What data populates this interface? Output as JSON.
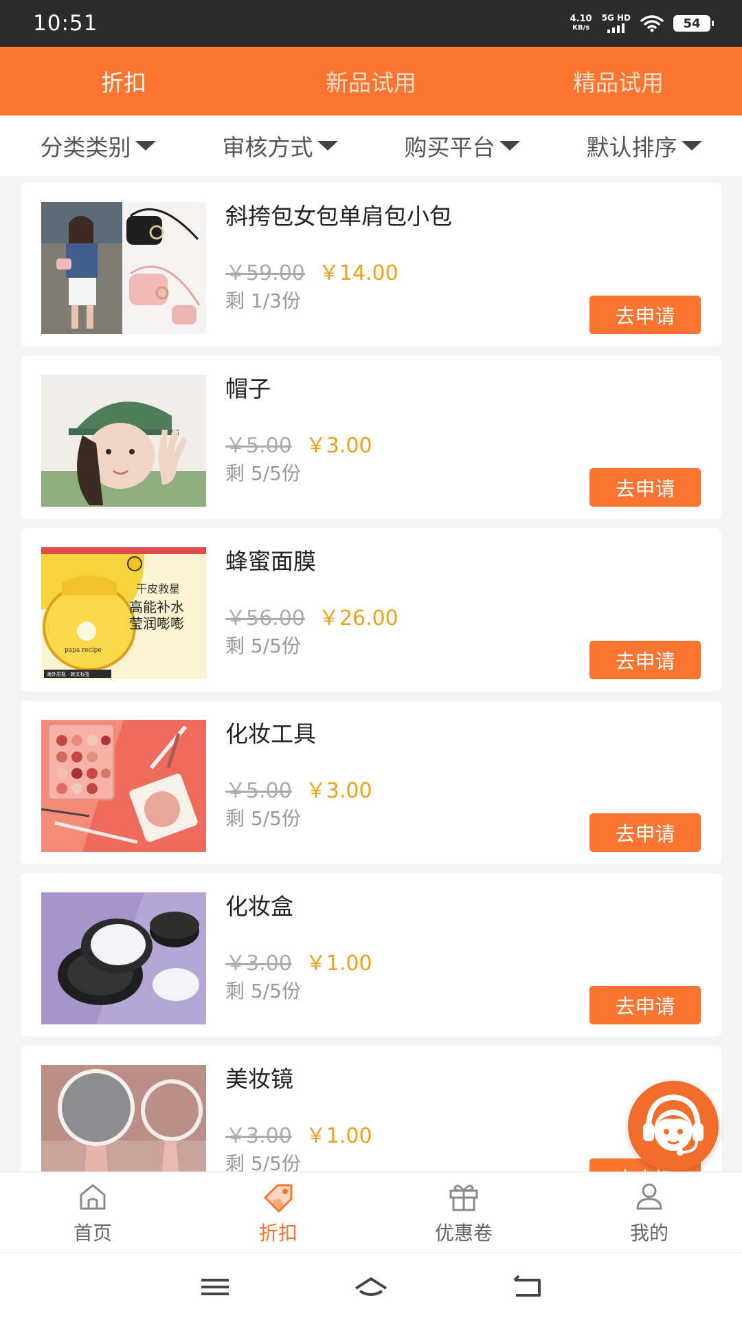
{
  "status": {
    "time": "10:51",
    "net_speed_value": "4.10",
    "net_speed_unit": "KB/s",
    "signal_label": "5G HD",
    "battery": "54"
  },
  "top_tabs": [
    {
      "label": "折扣",
      "active": true
    },
    {
      "label": "新品试用",
      "active": false
    },
    {
      "label": "精品试用",
      "active": false
    }
  ],
  "filters": [
    {
      "label": "分类类别"
    },
    {
      "label": "审核方式"
    },
    {
      "label": "购买平台"
    },
    {
      "label": "默认排序"
    }
  ],
  "products": [
    {
      "title": "斜挎包女包单肩包小包",
      "old_price": "￥59.00",
      "new_price": "￥14.00",
      "remain": "剩 1/3份",
      "button": "去申请",
      "image": "bag-photo"
    },
    {
      "title": "帽子",
      "old_price": "￥5.00",
      "new_price": "￥3.00",
      "remain": "剩 5/5份",
      "button": "去申请",
      "image": "cap-photo"
    },
    {
      "title": "蜂蜜面膜",
      "old_price": "￥56.00",
      "new_price": "￥26.00",
      "remain": "剩 5/5份",
      "button": "去申请",
      "image": "mask-photo",
      "image_texts": [
        "干皮救星",
        "高能补水",
        "莹润嘭嘭",
        "papa recipe",
        "海外原瓶 · 韩文标签"
      ]
    },
    {
      "title": "化妆工具",
      "old_price": "￥5.00",
      "new_price": "￥3.00",
      "remain": "剩 5/5份",
      "button": "去申请",
      "image": "makeup-tools-photo"
    },
    {
      "title": "化妆盒",
      "old_price": "￥3.00",
      "new_price": "￥1.00",
      "remain": "剩 5/5份",
      "button": "去申请",
      "image": "makeup-case-photo"
    },
    {
      "title": "美妆镜",
      "old_price": "￥3.00",
      "new_price": "￥1.00",
      "remain": "剩 5/5份",
      "button": "去申请",
      "image": "mirror-photo"
    }
  ],
  "bottom_nav": [
    {
      "label": "首页",
      "icon": "home-icon",
      "active": false
    },
    {
      "label": "折扣",
      "icon": "tag-icon",
      "active": true
    },
    {
      "label": "优惠卷",
      "icon": "gift-icon",
      "active": false
    },
    {
      "label": "我的",
      "icon": "user-icon",
      "active": false
    }
  ],
  "colors": {
    "accent": "#fb7530",
    "price": "#f0a11c"
  }
}
